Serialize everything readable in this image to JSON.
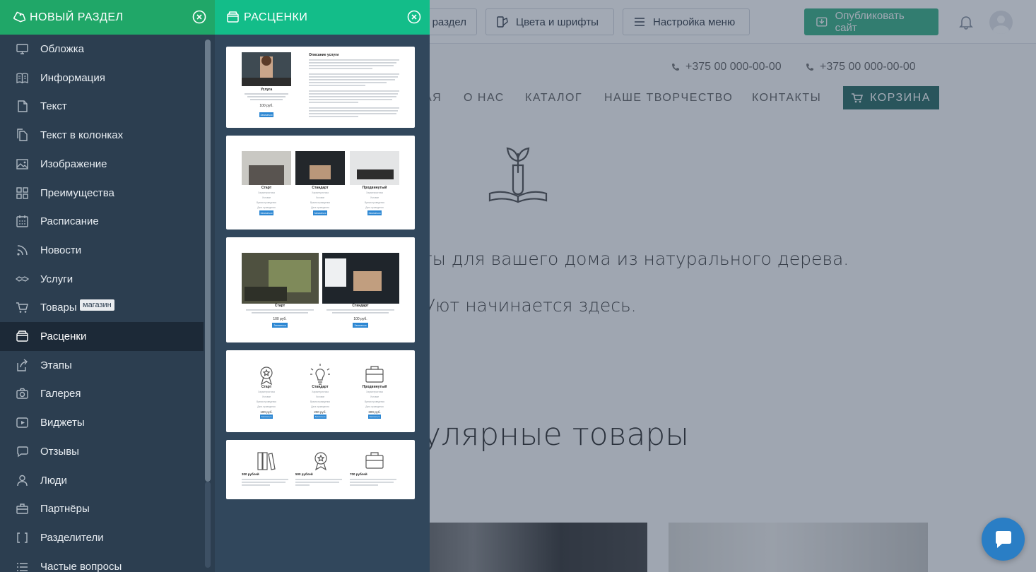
{
  "topbar": {
    "section_label": "раздел",
    "colors_fonts_label": "Цвета и шрифты",
    "menu_settings_label": "Настройка меню",
    "publish_label": "Опубликовать сайт"
  },
  "site": {
    "phones": [
      "+375 00 000-00-00",
      "+375 00 000-00-00"
    ],
    "nav": [
      "АЯ",
      "О НАС",
      "КАТАЛОГ",
      "НАШЕ ТВОРЧЕСТВО",
      "КОНТАКТЫ"
    ],
    "cart_label": "КОРЗИНА",
    "hero_line_1": "ты для вашего дома из натурального дерева.",
    "hero_line_2": "Уют начинается здесь.",
    "popular_heading": "улярные товары"
  },
  "left_panel": {
    "title": "НОВЫЙ РАЗДЕЛ",
    "active_item": "Расценки",
    "items": [
      {
        "label": "Обложка",
        "icon": "monitor-icon"
      },
      {
        "label": "Информация",
        "icon": "book-icon"
      },
      {
        "label": "Текст",
        "icon": "document-icon"
      },
      {
        "label": "Текст в колонках",
        "icon": "documents-icon"
      },
      {
        "label": "Изображение",
        "icon": "image-icon"
      },
      {
        "label": "Преимущества",
        "icon": "grid-icon"
      },
      {
        "label": "Расписание",
        "icon": "calendar-icon"
      },
      {
        "label": "Новости",
        "icon": "rss-icon"
      },
      {
        "label": "Услуги",
        "icon": "handshake-icon"
      },
      {
        "label": "Товары",
        "icon": "cart-icon",
        "badge": "магазин"
      },
      {
        "label": "Расценки",
        "icon": "wallet-icon"
      },
      {
        "label": "Этапы",
        "icon": "share-icon"
      },
      {
        "label": "Галерея",
        "icon": "camera-icon"
      },
      {
        "label": "Виджеты",
        "icon": "play-icon"
      },
      {
        "label": "Отзывы",
        "icon": "chat-bubble-icon"
      },
      {
        "label": "Люди",
        "icon": "person-icon"
      },
      {
        "label": "Партнёры",
        "icon": "briefcase-icon"
      },
      {
        "label": "Разделители",
        "icon": "brackets-icon"
      },
      {
        "label": "Частые вопросы",
        "icon": "list-icon"
      }
    ]
  },
  "mid_panel": {
    "title": "РАСЦЕНКИ",
    "templates": [
      {
        "name": "Описание услуги",
        "service_label": "Услуга",
        "price": "100 руб.",
        "button": "Записаться"
      },
      {
        "plans": [
          "Старт",
          "Стандарт",
          "Продвинутый"
        ],
        "rows": [
          "Характеристика",
          "Условие",
          "Время проведения",
          "Дата проведения"
        ],
        "button": "Записаться"
      },
      {
        "plans": [
          "Старт",
          "Стандарт"
        ],
        "prices": [
          "100 руб.",
          "100 руб."
        ],
        "button": "Записаться"
      },
      {
        "plans": [
          "Старт",
          "Стандарт",
          "Продвинутый"
        ],
        "rows": [
          "Характеристика",
          "Условие",
          "Время проведения",
          "Дата проведения"
        ],
        "prices": [
          "100 руб.",
          "200 руб.",
          "300 руб."
        ],
        "button": "Записаться"
      },
      {
        "prices": [
          "300 рублей",
          "500 рублей",
          "700 рублей"
        ]
      }
    ]
  },
  "colors": {
    "left_header": "#20a768",
    "mid_header": "#13bd89",
    "left_panel_bg": "#2c3e50",
    "mid_panel_bg": "#31475c",
    "publish": "#3fb38b",
    "cart": "#2f6f68",
    "chat": "#2a7ec5"
  }
}
